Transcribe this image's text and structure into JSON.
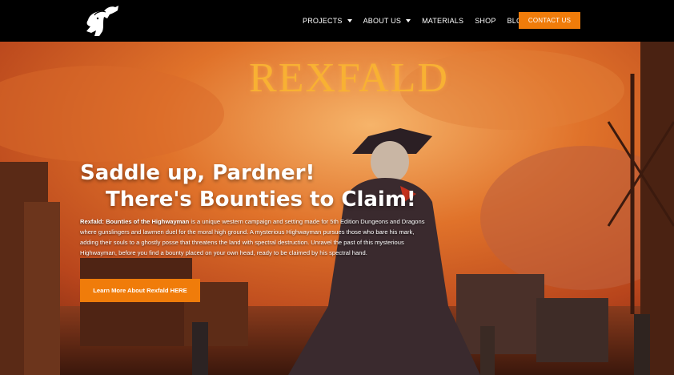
{
  "header": {
    "nav": {
      "projects": "PROJECTS",
      "about_us": "ABOUT US",
      "materials": "MATERIALS",
      "shop": "SHOP",
      "blog": "BLOG"
    },
    "contact_label": "CONTACT US"
  },
  "hero": {
    "brand_title": "REXFALD",
    "headline_line1": "Saddle up, Pardner!",
    "headline_line2": "There's Bounties to Claim!",
    "description_bold": "Rexfald: Bounties of the Highwayman",
    "description_rest": " is a unique western campaign and setting made for 5th Edition Dungeons and Dragons where gunslingers and lawmen duel for the moral high ground. A mysterious Highwayman pursues those who bare his mark, adding their souls to a ghostly posse that threatens the land with spectral destruction. Unravel the past of this mysterious Highwayman, before you find a bounty placed on your own head, ready to be claimed by his spectral hand.",
    "cta_label": "Learn More About Rexfald HERE"
  },
  "colors": {
    "accent": "#f07c0a",
    "header_bg": "#000000",
    "title_gold": "#f8b133",
    "sky_orange": "#d0541a"
  }
}
